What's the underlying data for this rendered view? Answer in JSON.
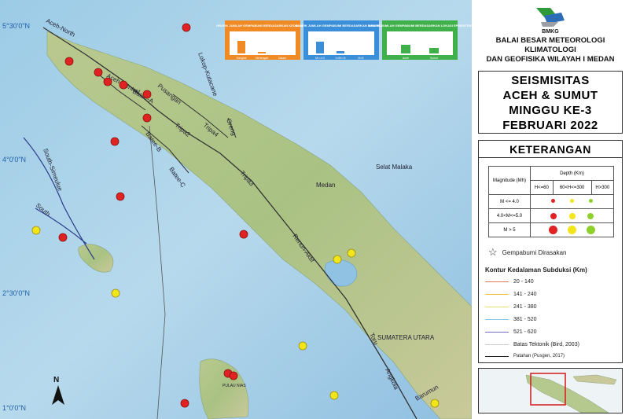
{
  "map": {
    "lat_labels": [
      "5°30'0\"N",
      "4°0'0\"N",
      "2°30'0\"N",
      "1°0'0\"N"
    ],
    "fault_labels": [
      "Aceh-North",
      "Aceh-Central",
      "Batee-A",
      "Pusangan",
      "Lokop-Kutacane",
      "Oreng",
      "Tripa4",
      "Tripa3",
      "Tripa2",
      "Batee-B",
      "Batee-C",
      "South-Simeulue",
      "South",
      "Renun-Aktif",
      "Toru",
      "Angkola",
      "Barumun"
    ],
    "place_labels": [
      "Medan",
      "Selat Malaka",
      "SUMATERA UTARA",
      "PULAU NIAS"
    ],
    "north_label": "N",
    "colors": {
      "shallow": "#e02222",
      "mid": "#f2e51a",
      "deep": "#8fd12a"
    }
  },
  "mini_charts": [
    {
      "title": "GRAFIK JUMLAH GEMPABUMI BERDASARKAN KEDALAMAN",
      "color": "#f08a24",
      "categories": [
        "Dangkal",
        "Menengah",
        "Dalam"
      ],
      "values": [
        16,
        2,
        0
      ]
    },
    {
      "title": "GRAFIK JUMLAH GEMPABUMI BERDASARKAN MAGNITUDO",
      "color": "#3a8fd8",
      "categories": [
        "M<=4.0",
        "4<M<=5",
        "M>5"
      ],
      "values": [
        15,
        3,
        0
      ]
    },
    {
      "title": "GRAFIK JUMLAH GEMPABUMI BERDASARKAN LOKASI EPISENTER",
      "color": "#3fb04a",
      "categories": [
        "Aceh",
        "Sumut"
      ],
      "values": [
        11,
        7
      ]
    }
  ],
  "panel": {
    "logo_text": "BMKG",
    "org_line1": "BALAI BESAR METEOROLOGI KLIMATOLOGI",
    "org_line2": "DAN GEOFISIKA WILAYAH I MEDAN",
    "title_line1": "SEISMISITAS",
    "title_line2": "ACEH & SUMUT",
    "title_line3": "MINGGU KE-3",
    "title_line4": "FEBRUARI 2022",
    "legend_title": "KETERANGAN",
    "mag_header": "Magnitude (Mh)",
    "depth_header": "Depth (Km)",
    "depth_cols": [
      "H<=60",
      "60<H<=300",
      "H>300"
    ],
    "mag_rows": [
      "M <= 4.0",
      "4.0<M<=5.0",
      "M > 5"
    ],
    "felt_label": "Gempabumi Dirasakan",
    "contour_title": "Kontur Kedalaman Subduksi (Km)",
    "contours": [
      {
        "label": "20 - 140",
        "color": "#e0795a"
      },
      {
        "label": "141 - 240",
        "color": "#f0c23a"
      },
      {
        "label": "241 - 380",
        "color": "#e8e06a"
      },
      {
        "label": "381 - 520",
        "color": "#8ec6e8"
      },
      {
        "label": "521 - 620",
        "color": "#6a6ac8"
      }
    ],
    "tectonic_label": "Batas Tektonik (Bird, 2003)",
    "tectonic_color": "#c9c9c9",
    "fault_label": "Patahan (Pusgen, 2017)",
    "fault_color": "#222222"
  }
}
